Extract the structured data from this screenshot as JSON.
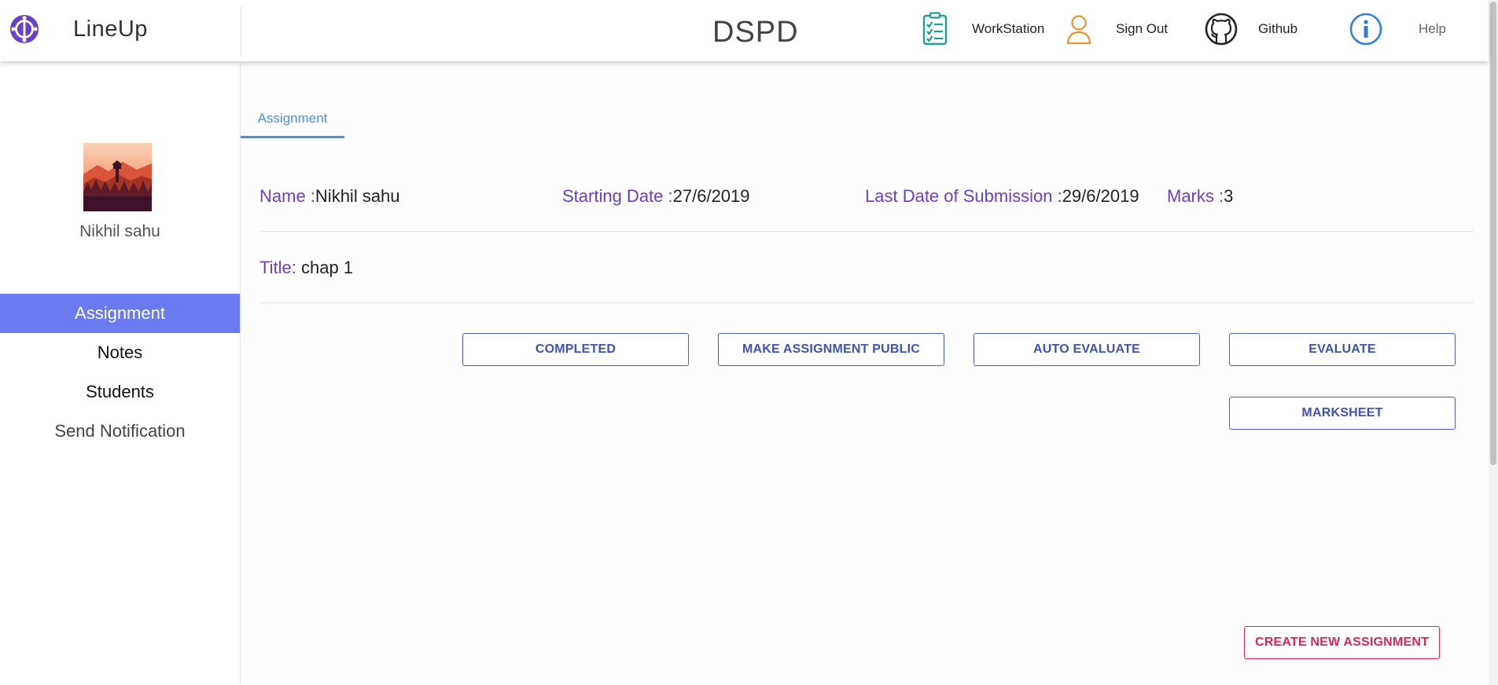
{
  "header": {
    "brand_name": "LineUp",
    "course_title": "DSPD",
    "nav": {
      "workstation": "WorkStation",
      "sign_out": "Sign Out",
      "github": "Github",
      "help": "Help"
    }
  },
  "sidebar": {
    "profile_name": "Nikhil sahu",
    "items": [
      "Assignment",
      "Notes",
      "Students",
      "Send Notification"
    ],
    "active_item": "Assignment"
  },
  "main": {
    "tab": "Assignment",
    "assignment": {
      "name_label": "Name :",
      "name_value": "Nikhil sahu",
      "start_label": "Starting Date :",
      "start_value": "27/6/2019",
      "last_label": "Last Date of Submission :",
      "last_value": "29/6/2019",
      "marks_label": "Marks :",
      "marks_value": "3",
      "title_label": "Title:",
      "title_value": " chap 1"
    },
    "buttons": {
      "completed": "COMPLETED",
      "make_public": "MAKE ASSIGNMENT PUBLIC",
      "auto_evaluate": "AUTO EVALUATE",
      "evaluate": "EVALUATE",
      "marksheet": "MARKSHEET",
      "create_new": "CREATE NEW ASSIGNMENT"
    }
  },
  "icons": {
    "brand": "lineup-logo-icon",
    "workstation": "clipboard-checklist-icon",
    "sign_out": "user-outline-icon",
    "github": "github-icon",
    "help": "info-icon"
  },
  "colors": {
    "accent": "#6a7bf0",
    "label_purple": "#6a3fc8",
    "button_blue": "#3f51b5",
    "button_pink": "#e0245e",
    "tab_blue": "#4a8fd9"
  }
}
